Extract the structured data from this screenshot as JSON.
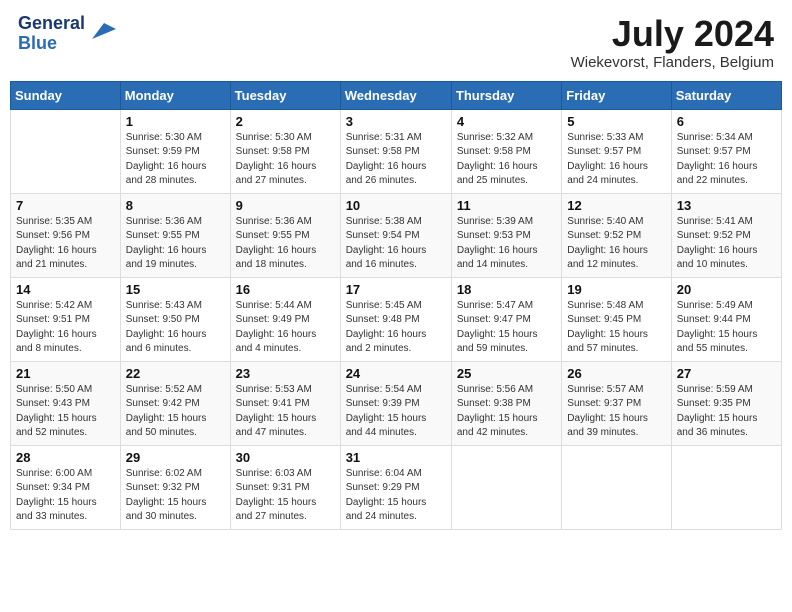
{
  "header": {
    "logo_line1": "General",
    "logo_line2": "Blue",
    "month_year": "July 2024",
    "location": "Wiekevorst, Flanders, Belgium"
  },
  "days_of_week": [
    "Sunday",
    "Monday",
    "Tuesday",
    "Wednesday",
    "Thursday",
    "Friday",
    "Saturday"
  ],
  "weeks": [
    [
      {
        "day": "",
        "info": ""
      },
      {
        "day": "1",
        "info": "Sunrise: 5:30 AM\nSunset: 9:59 PM\nDaylight: 16 hours\nand 28 minutes."
      },
      {
        "day": "2",
        "info": "Sunrise: 5:30 AM\nSunset: 9:58 PM\nDaylight: 16 hours\nand 27 minutes."
      },
      {
        "day": "3",
        "info": "Sunrise: 5:31 AM\nSunset: 9:58 PM\nDaylight: 16 hours\nand 26 minutes."
      },
      {
        "day": "4",
        "info": "Sunrise: 5:32 AM\nSunset: 9:58 PM\nDaylight: 16 hours\nand 25 minutes."
      },
      {
        "day": "5",
        "info": "Sunrise: 5:33 AM\nSunset: 9:57 PM\nDaylight: 16 hours\nand 24 minutes."
      },
      {
        "day": "6",
        "info": "Sunrise: 5:34 AM\nSunset: 9:57 PM\nDaylight: 16 hours\nand 22 minutes."
      }
    ],
    [
      {
        "day": "7",
        "info": "Sunrise: 5:35 AM\nSunset: 9:56 PM\nDaylight: 16 hours\nand 21 minutes."
      },
      {
        "day": "8",
        "info": "Sunrise: 5:36 AM\nSunset: 9:55 PM\nDaylight: 16 hours\nand 19 minutes."
      },
      {
        "day": "9",
        "info": "Sunrise: 5:36 AM\nSunset: 9:55 PM\nDaylight: 16 hours\nand 18 minutes."
      },
      {
        "day": "10",
        "info": "Sunrise: 5:38 AM\nSunset: 9:54 PM\nDaylight: 16 hours\nand 16 minutes."
      },
      {
        "day": "11",
        "info": "Sunrise: 5:39 AM\nSunset: 9:53 PM\nDaylight: 16 hours\nand 14 minutes."
      },
      {
        "day": "12",
        "info": "Sunrise: 5:40 AM\nSunset: 9:52 PM\nDaylight: 16 hours\nand 12 minutes."
      },
      {
        "day": "13",
        "info": "Sunrise: 5:41 AM\nSunset: 9:52 PM\nDaylight: 16 hours\nand 10 minutes."
      }
    ],
    [
      {
        "day": "14",
        "info": "Sunrise: 5:42 AM\nSunset: 9:51 PM\nDaylight: 16 hours\nand 8 minutes."
      },
      {
        "day": "15",
        "info": "Sunrise: 5:43 AM\nSunset: 9:50 PM\nDaylight: 16 hours\nand 6 minutes."
      },
      {
        "day": "16",
        "info": "Sunrise: 5:44 AM\nSunset: 9:49 PM\nDaylight: 16 hours\nand 4 minutes."
      },
      {
        "day": "17",
        "info": "Sunrise: 5:45 AM\nSunset: 9:48 PM\nDaylight: 16 hours\nand 2 minutes."
      },
      {
        "day": "18",
        "info": "Sunrise: 5:47 AM\nSunset: 9:47 PM\nDaylight: 15 hours\nand 59 minutes."
      },
      {
        "day": "19",
        "info": "Sunrise: 5:48 AM\nSunset: 9:45 PM\nDaylight: 15 hours\nand 57 minutes."
      },
      {
        "day": "20",
        "info": "Sunrise: 5:49 AM\nSunset: 9:44 PM\nDaylight: 15 hours\nand 55 minutes."
      }
    ],
    [
      {
        "day": "21",
        "info": "Sunrise: 5:50 AM\nSunset: 9:43 PM\nDaylight: 15 hours\nand 52 minutes."
      },
      {
        "day": "22",
        "info": "Sunrise: 5:52 AM\nSunset: 9:42 PM\nDaylight: 15 hours\nand 50 minutes."
      },
      {
        "day": "23",
        "info": "Sunrise: 5:53 AM\nSunset: 9:41 PM\nDaylight: 15 hours\nand 47 minutes."
      },
      {
        "day": "24",
        "info": "Sunrise: 5:54 AM\nSunset: 9:39 PM\nDaylight: 15 hours\nand 44 minutes."
      },
      {
        "day": "25",
        "info": "Sunrise: 5:56 AM\nSunset: 9:38 PM\nDaylight: 15 hours\nand 42 minutes."
      },
      {
        "day": "26",
        "info": "Sunrise: 5:57 AM\nSunset: 9:37 PM\nDaylight: 15 hours\nand 39 minutes."
      },
      {
        "day": "27",
        "info": "Sunrise: 5:59 AM\nSunset: 9:35 PM\nDaylight: 15 hours\nand 36 minutes."
      }
    ],
    [
      {
        "day": "28",
        "info": "Sunrise: 6:00 AM\nSunset: 9:34 PM\nDaylight: 15 hours\nand 33 minutes."
      },
      {
        "day": "29",
        "info": "Sunrise: 6:02 AM\nSunset: 9:32 PM\nDaylight: 15 hours\nand 30 minutes."
      },
      {
        "day": "30",
        "info": "Sunrise: 6:03 AM\nSunset: 9:31 PM\nDaylight: 15 hours\nand 27 minutes."
      },
      {
        "day": "31",
        "info": "Sunrise: 6:04 AM\nSunset: 9:29 PM\nDaylight: 15 hours\nand 24 minutes."
      },
      {
        "day": "",
        "info": ""
      },
      {
        "day": "",
        "info": ""
      },
      {
        "day": "",
        "info": ""
      }
    ]
  ]
}
